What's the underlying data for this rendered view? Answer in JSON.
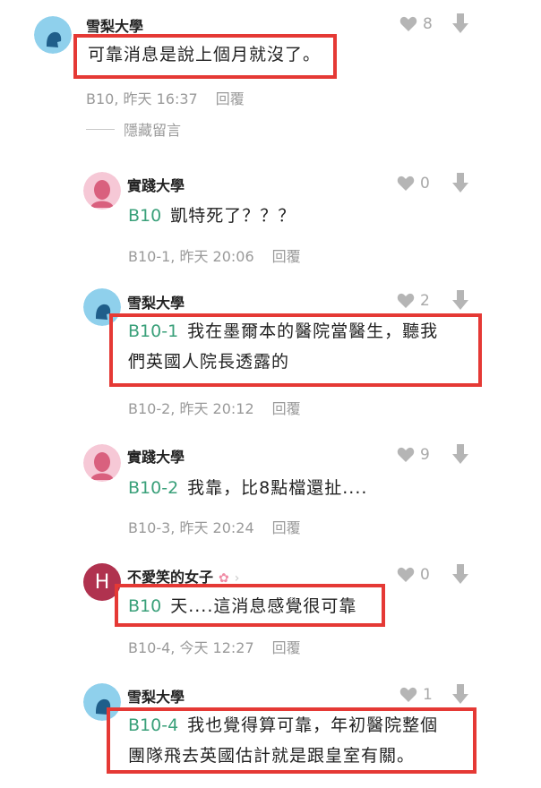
{
  "comments": [
    {
      "username": "雪梨大學",
      "likes": "8",
      "ref": "",
      "text": "可靠消息是說上個月就沒了。",
      "meta": "B10, 昨天 16:37",
      "reply": "回覆"
    },
    {
      "username": "實踐大學",
      "likes": "0",
      "ref": "B10",
      "text": "凱特死了？？？",
      "meta": "B10-1, 昨天 20:06",
      "reply": "回覆"
    },
    {
      "username": "雪梨大學",
      "likes": "2",
      "ref": "B10-1",
      "text": "我在墨爾本的醫院當醫生，聽我",
      "text2": "們英國人院長透露的",
      "meta": "B10-2, 昨天 20:12",
      "reply": "回覆"
    },
    {
      "username": "實踐大學",
      "likes": "9",
      "ref": "B10-2",
      "text": "我靠，比8點檔還扯....",
      "meta": "B10-3, 昨天 20:24",
      "reply": "回覆"
    },
    {
      "username": "不愛笑的女子",
      "avatar_letter": "H",
      "likes": "0",
      "ref": "B10",
      "text": "天....這消息感覺很可靠",
      "meta": "B10-4, 今天 12:27",
      "reply": "回覆"
    },
    {
      "username": "雪梨大學",
      "likes": "1",
      "ref": "B10-4",
      "text": "我也覺得算可靠，年初醫院整個",
      "text2": "團隊飛去英國估計就是跟皇室有關。"
    }
  ],
  "hidden_replies_label": "隱藏留言",
  "colors": {
    "highlight": "#e53935",
    "reply_ref": "#3aa07a",
    "muted": "#9a9a9a",
    "avatar_h": "#b0324f"
  },
  "icons": [
    "heart-icon",
    "dislike-arrow-icon",
    "user-avatar-icon",
    "chevron-right-icon",
    "flower-icon"
  ]
}
